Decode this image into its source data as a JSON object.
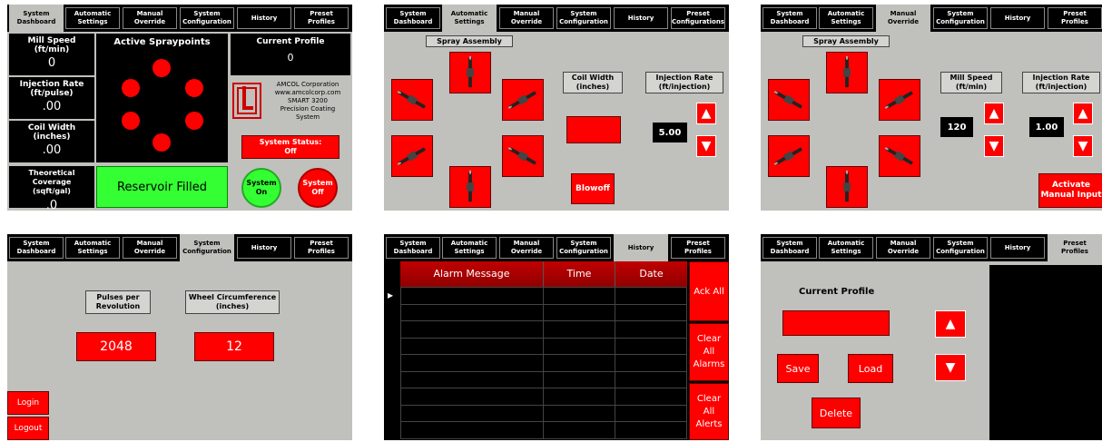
{
  "tabs": [
    "System\nDashboard",
    "Automatic\nSettings",
    "Manual\nOverride",
    "System\nConfiguration",
    "History",
    "Preset\nProfiles"
  ],
  "tabs_p2": [
    "System\nDashboard",
    "Automatic\nSettings",
    "Manual\nOverride",
    "System\nConfiguration",
    "History",
    "Preset\nConfigurations"
  ],
  "colors": {
    "panel_bg": "#c0c0bc",
    "red": "#ff0000",
    "green": "#33ff33",
    "black": "#000000",
    "header_red": "#b00000"
  },
  "dashboard": {
    "mill_speed_label": "Mill Speed\n(ft/min)",
    "mill_speed_value": "0",
    "injection_rate_label": "Injection Rate\n(ft/pulse)",
    "injection_rate_value": ".00",
    "coil_width_label": "Coil Width\n(inches)",
    "coil_width_value": ".00",
    "coverage_label": "Theoretical Coverage\n(sqft/gal)",
    "coverage_value": ".0",
    "spraypoints_title": "Active Spraypoints",
    "current_profile_label": "Current Profile",
    "current_profile_value": "0",
    "company_text": "AMCOL Corporation\nwww.amcolcorp.com\nSMART 3200\nPrecision Coating\nSystem",
    "status_label": "System Status:\nOff",
    "reservoir_label": "Reservoir Filled",
    "system_on_label": "System\nOn",
    "system_off_label": "System\nOff"
  },
  "automatic": {
    "spray_assembly_label": "Spray Assembly",
    "coil_width_label": "Coil Width\n(inches)",
    "injection_rate_label": "Injection Rate\n(ft/injection)",
    "injection_rate_value": "5.00",
    "blowoff_label": "Blowoff"
  },
  "manual": {
    "spray_assembly_label": "Spray Assembly",
    "mill_speed_label": "Mill Speed\n(ft/min)",
    "mill_speed_value": "120",
    "injection_rate_label": "Injection Rate\n(ft/injection)",
    "injection_rate_value": "1.00",
    "activate_label": "Activate\nManual Input"
  },
  "config": {
    "pulses_label": "Pulses per\nRevolution",
    "pulses_value": "2048",
    "wheel_label": "Wheel Circumference\n(inches)",
    "wheel_value": "12",
    "login_label": "Login",
    "logout_label": "Logout"
  },
  "history": {
    "columns": [
      "Alarm Message",
      "Time",
      "Date"
    ],
    "ack_all_label": "Ack All",
    "clear_alarms_label": "Clear\nAll\nAlarms",
    "clear_alerts_label": "Clear\nAll\nAlerts"
  },
  "profiles": {
    "current_profile_label": "Current Profile",
    "save_label": "Save",
    "load_label": "Load",
    "delete_label": "Delete"
  },
  "icons": {
    "up": "▲",
    "down": "▼",
    "row_pointer": "▸"
  }
}
